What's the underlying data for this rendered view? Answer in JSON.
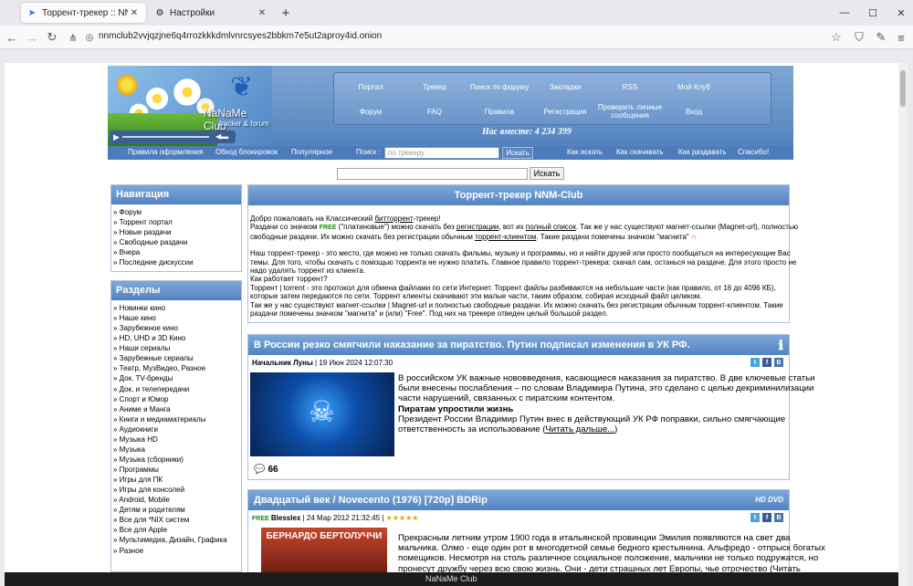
{
  "browser": {
    "tabs": [
      {
        "title": "Торрент-трекер :: NNM-Club",
        "active": true
      },
      {
        "title": "Настройки",
        "active": false
      }
    ],
    "new_tab_label": "+",
    "url": "nnmclub2vvjqzjne6q4rrozkkkdmlvnrcsyes2bbkm7e5ut2aproy4id.onion",
    "window_controls": [
      "—",
      "☐",
      "✕"
    ]
  },
  "banner": {
    "brand": "NaNaMe Club",
    "brand_sub": "tracker & forum",
    "online_text": "Нас вместе: 4 234 399",
    "menu": [
      "Портал",
      "Трекер",
      "Поиск по форуму",
      "Закладки",
      "RSS",
      "Мой Клуб",
      "Форум",
      "FAQ",
      "Правила",
      "Регистрация",
      "Проверить личные сообщения",
      "Вход"
    ]
  },
  "subnav": {
    "links": [
      "Правила оформления",
      "Обход блокировок",
      "Популярное"
    ],
    "search_label": "Поиск :",
    "search_placeholder": "по трекеру",
    "search_button": "Искать",
    "right_links": [
      "Как искать",
      "Как скачивать",
      "Как раздавать",
      "Спасибо!"
    ]
  },
  "main_search": {
    "button": "Искать"
  },
  "navigation": {
    "title": "Навигация",
    "items": [
      "» Форум",
      "» Торрент портал",
      "» Новые раздачи",
      "» Свободные раздачи",
      "» Вчера",
      "» Последние дискуссии"
    ]
  },
  "sections": {
    "title": "Разделы",
    "items": [
      "» Новинки кино",
      "» Наше кино",
      "» Зарубежное кино",
      "» HD, UHD и 3D Кино",
      "» Наши сериалы",
      "» Зарубежные сериалы",
      "» Театр, МузВидео, Разное",
      "» Док. TV-бренды",
      "» Док. и телепередачи",
      "» Спорт и Юмор",
      "» Аниме и Манга",
      "» Книги и медиаматериалы",
      "» Аудиокниги",
      "» Музыка HD",
      "» Музыка",
      "» Музыка (сборники)",
      "» Программы",
      "» Игры для ПК",
      "» Игры для консолей",
      "» Android, Mobile",
      "» Детям и родителям",
      "» Все для *NIX систем",
      "» Все для Apple",
      "» Мультимедиа, Дизайн, Графика",
      "» Разное"
    ]
  },
  "intro": {
    "title": "Торрент-трекер NNM-Club",
    "l1_a": "Добро пожаловать на Классический ",
    "l1_link": "битторрент",
    "l1_b": "-трекер!",
    "l2_a": "Раздачи со значком ",
    "free_badge": "FREE",
    "l2_b": " (\"платиновые\") можно скачать без ",
    "l2_link1": "регистрации",
    "l2_c": ", вот их ",
    "l2_link2": "полный список",
    "l2_d": ". Так же у нас существуют магнет-ссылки (Magnet-url), полностью",
    "l3_a": "свободные раздачи. Их можно скачать без регистрации обычным ",
    "l3_link": "торрент-клиентом",
    "l3_b": ". Такие раздачи помечены значком \"магнита\"",
    "p2": [
      "Наш торрент-трекер - это место, где можно не только скачать фильмы, музыку и программы, но и найти друзей или просто пообщаться на интересующие Вас",
      "темы. Для того, чтобы скачать с помощью торрента не нужно платить. Главное правило торрент-трекера: скачал сам, останься на раздаче. Для этого просто не",
      "надо удалять торрент из клиента.",
      "Как работает торрент?",
      "Торрент | torrent - это протокол для обмена файлами по сети Интернет. Торрент файлы разбиваются на небольшие части (как правило, от 16 до 4096 КБ),",
      "которые затем передаются по сети. Торрент клиенты скачивают эти малые части, таким образом, собирая исходный файл целиком.",
      "Так же у нас существуют магнет-ссылки | Magnet-url и полностью свободные раздачи. Их можно скачать без регистрации обычным торрент-клиентом. Такие",
      "раздачи помечены значком \"магнита\" и (или) \"Free\". Под них на трекере отведен целый большой раздел."
    ]
  },
  "news1": {
    "title": "В России резко смягчили наказание за пиратство. Путин подписал изменения в УК РФ.",
    "author": "Начальник Луны",
    "date": " | 19 Июн 2024 12:07:30",
    "body": [
      "В российском УК важные нововведения, касающиеся наказания за пиратство. В две ключевые статьи",
      "были внесены послабления – по словам Владимира Путина, это сделано с целью декриминилизации",
      "части нарушений, связанных с пиратским контентом."
    ],
    "subheading": "Пиратам упростили жизнь",
    "body2": [
      "Президент России Владимир Путин внес в действующий УК РФ поправки, сильно смягчающие",
      "ответственность за использование ("
    ],
    "read_more": "Читать дальше...",
    "read_more_close": ")",
    "comments": "66"
  },
  "news2": {
    "title": "Двадцатый век / Novecento (1976) [720p] BDRip",
    "badge": "HD DVD",
    "free_badge": "FREE",
    "author": "Blesslex",
    "date": " | 24 Мар 2012 21:32:45 | ",
    "stars": "★★★★★",
    "poster_text": "БЕРНАРДО БЕРТОЛУЧЧИ",
    "body": [
      "Прекрасным летним утром 1900 года в итальянской провинции Эмилия появляются на свет два",
      "мальчика. Олмо - еще один рот в многодетной семье бедного крестьянина. Альфредо - отпрыск богатых",
      "помещиков. Несмотря на столь различное социальное положение, мальчики не только подружатся, но",
      "пронесут дружбу через всю свою жизнь. Они - дети страшных лет Европы, чье отрочество ("
    ],
    "read_more": "Читать"
  },
  "footer": {
    "text": "NaNaMe Club"
  },
  "colors": {
    "accent": "#5283c2",
    "header_blue": "#4d7cba",
    "free_green": "#1a8a1a"
  }
}
